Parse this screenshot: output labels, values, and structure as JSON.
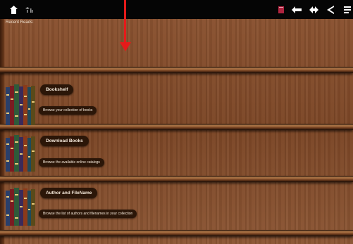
{
  "topbar": {
    "home_icon": "home-icon",
    "status_icons": "wifi-and-signal-icons"
  },
  "recent": {
    "label": "Recent Reads:"
  },
  "shelves": [
    {
      "title": "Bookshelf",
      "description": "Browse your collection of books"
    },
    {
      "title": "Download Books",
      "description": "Browse the available online catalogs"
    },
    {
      "title": "Author and FileName",
      "description": "Browse the list of authors and filenames in your collection"
    }
  ],
  "colors": {
    "annotation": "#e51a1a",
    "pill": "#2b1608"
  }
}
